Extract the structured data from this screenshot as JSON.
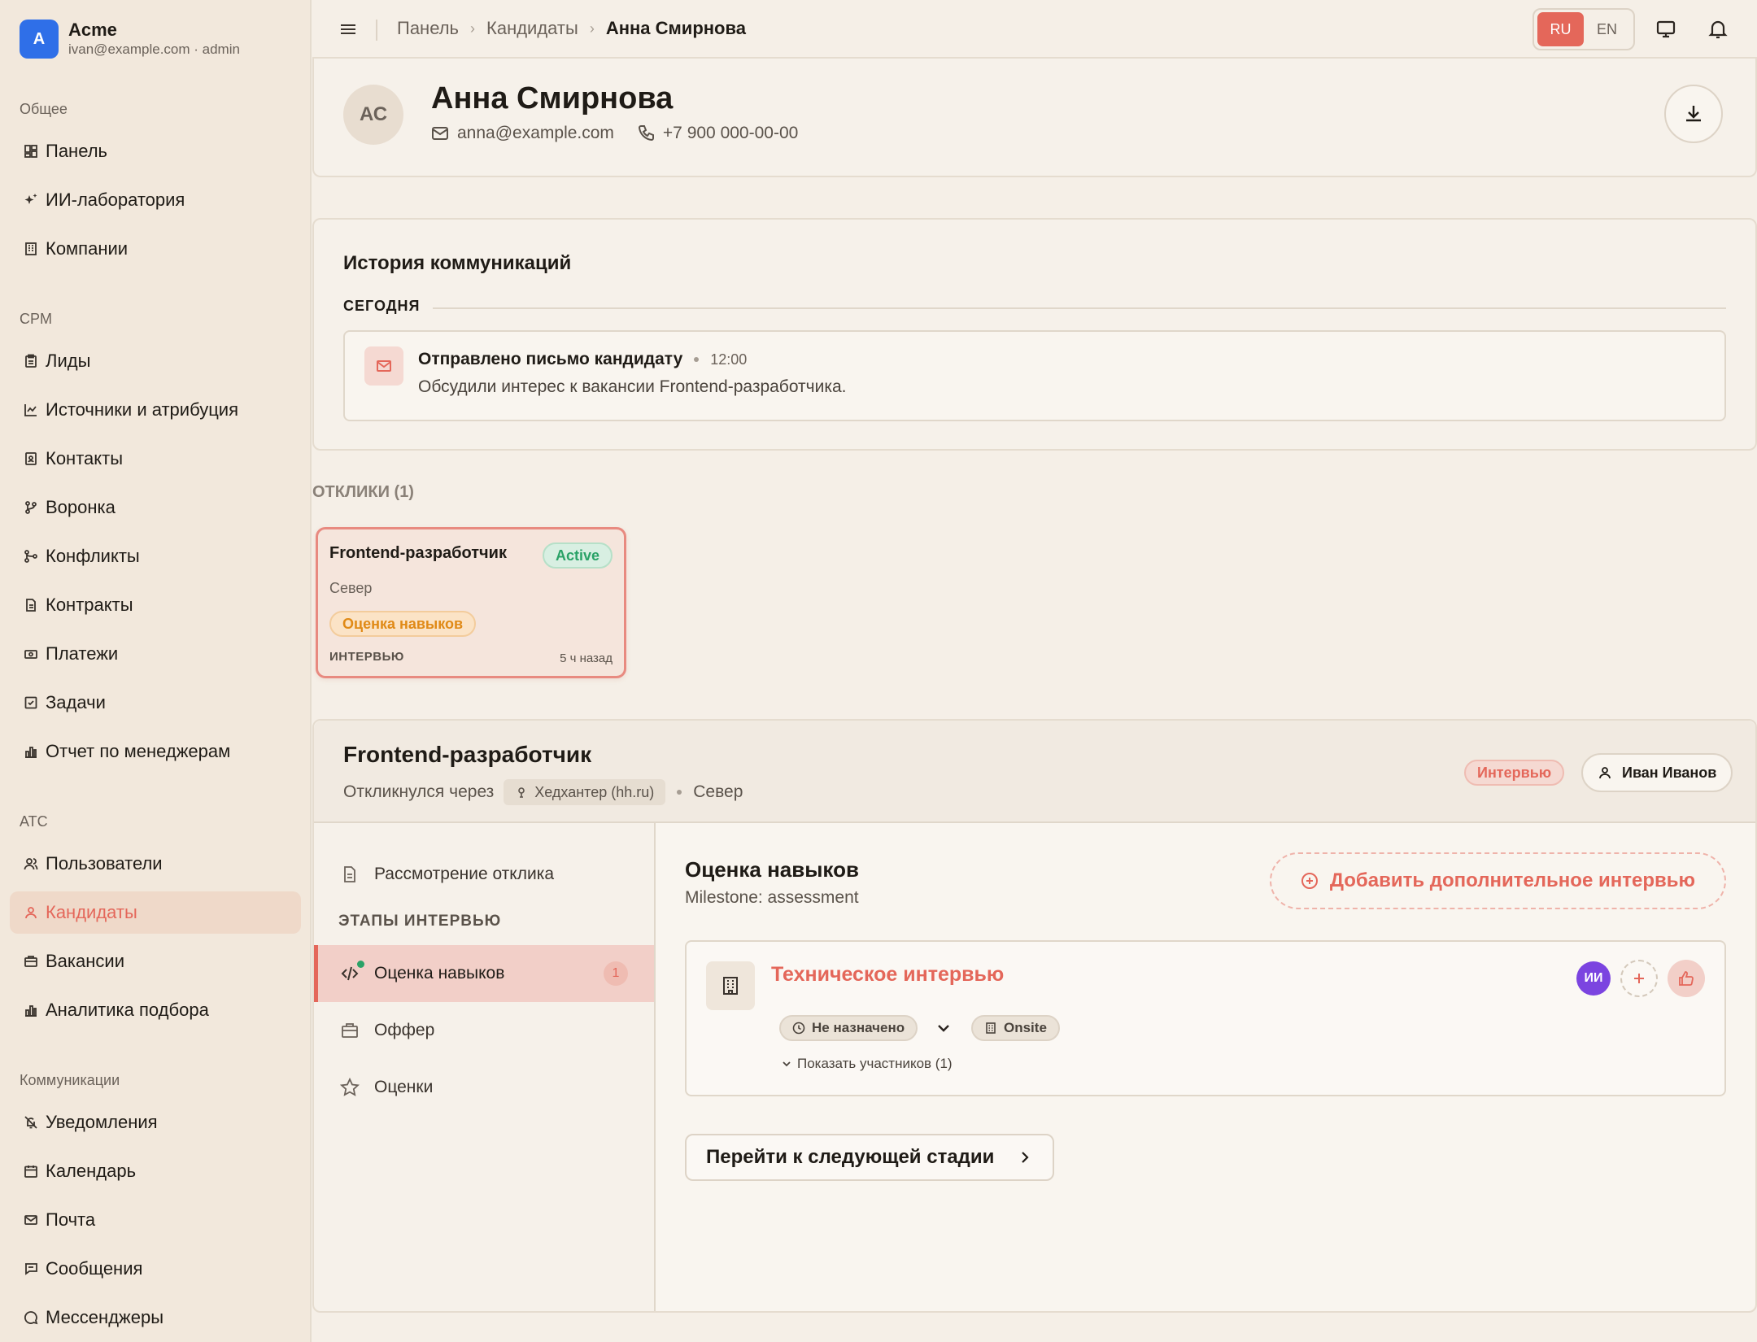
{
  "brand": {
    "logo_letter": "A",
    "name": "Acme",
    "sub": "ivan@example.com · admin",
    "color": "#2f6fe8"
  },
  "sidebar": {
    "groups": [
      {
        "title": "Общее",
        "items": [
          {
            "label": "Панель",
            "icon": "dashboard-icon"
          },
          {
            "label": "ИИ-лаборатория",
            "icon": "sparkles-icon"
          },
          {
            "label": "Компании",
            "icon": "building-icon"
          }
        ]
      },
      {
        "title": "CPM",
        "items": [
          {
            "label": "Лиды",
            "icon": "clipboard-icon"
          },
          {
            "label": "Источники и атрибуция",
            "icon": "chart-line-icon"
          },
          {
            "label": "Контакты",
            "icon": "contact-book-icon"
          },
          {
            "label": "Воронка",
            "icon": "git-branch-icon"
          },
          {
            "label": "Конфликты",
            "icon": "git-merge-icon"
          },
          {
            "label": "Контракты",
            "icon": "document-icon"
          },
          {
            "label": "Платежи",
            "icon": "banknote-icon"
          },
          {
            "label": "Задачи",
            "icon": "checkbox-icon"
          },
          {
            "label": "Отчет по менеджерам",
            "icon": "bar-chart-icon"
          }
        ]
      },
      {
        "title": "ATC",
        "items": [
          {
            "label": "Пользователи",
            "icon": "users-icon"
          },
          {
            "label": "Кандидаты",
            "icon": "user-icon",
            "active": true
          },
          {
            "label": "Вакансии",
            "icon": "briefcase-icon"
          },
          {
            "label": "Аналитика подбора",
            "icon": "bar-chart-icon"
          }
        ]
      },
      {
        "title": "Коммуникации",
        "items": [
          {
            "label": "Уведомления",
            "icon": "bell-off-icon"
          },
          {
            "label": "Календарь",
            "icon": "calendar-icon"
          },
          {
            "label": "Почта",
            "icon": "mail-icon"
          },
          {
            "label": "Сообщения",
            "icon": "message-square-icon"
          },
          {
            "label": "Мессенджеры",
            "icon": "message-circle-icon"
          }
        ]
      }
    ]
  },
  "topbar": {
    "breadcrumbs": [
      "Панель",
      "Кандидаты",
      "Анна Смирнова"
    ],
    "languages": [
      {
        "code": "RU",
        "active": true
      },
      {
        "code": "EN",
        "active": false
      }
    ]
  },
  "candidate": {
    "initials": "АС",
    "name": "Анна Смирнова",
    "email": "anna@example.com",
    "phone": "+7 900 000-00-00"
  },
  "communications": {
    "title": "История коммуникаций",
    "group_label": "СЕГОДНЯ",
    "events": [
      {
        "title": "Отправлено письмо кандидату",
        "time": "12:00",
        "description": "Обсудили интерес к вакансии Frontend-разработчика."
      }
    ]
  },
  "applications": {
    "label": "ОТКЛИКИ (1)",
    "items": [
      {
        "title": "Frontend-разработчик",
        "status": "Active",
        "region": "Север",
        "stage": "Оценка навыков",
        "stage_group": "ИНТЕРВЬЮ",
        "ago": "5 ч назад"
      }
    ]
  },
  "pipeline": {
    "title": "Frontend-разработчик",
    "responded_via": "Откликнулся через",
    "source": "Хедхантер (hh.ru)",
    "region": "Север",
    "status_badge": "Интервью",
    "owner": "Иван Иванов",
    "review_stage": "Рассмотрение отклика",
    "stages_label": "ЭТАПЫ ИНТЕРВЬЮ",
    "stages": [
      {
        "label": "Оценка навыков",
        "icon": "code-icon",
        "count": "1",
        "active": true
      },
      {
        "label": "Оффер",
        "icon": "briefcase-icon"
      },
      {
        "label": "Оценки",
        "icon": "star-icon"
      }
    ],
    "detail": {
      "title": "Оценка навыков",
      "milestone": "Milestone: assessment",
      "add_interview": "Добавить дополнительное интервью",
      "interview": {
        "title": "Техническое интервью",
        "schedule": "Не назначено",
        "format": "Onsite",
        "show_participants": "Показать участников (1)",
        "participant_initials": "ИИ"
      },
      "next_stage": "Перейти к следующей стадии"
    }
  },
  "colors": {
    "accent": "#e4675a",
    "success": "#2aa267",
    "warning": "#e08a17",
    "participant": "#7b44e0"
  }
}
